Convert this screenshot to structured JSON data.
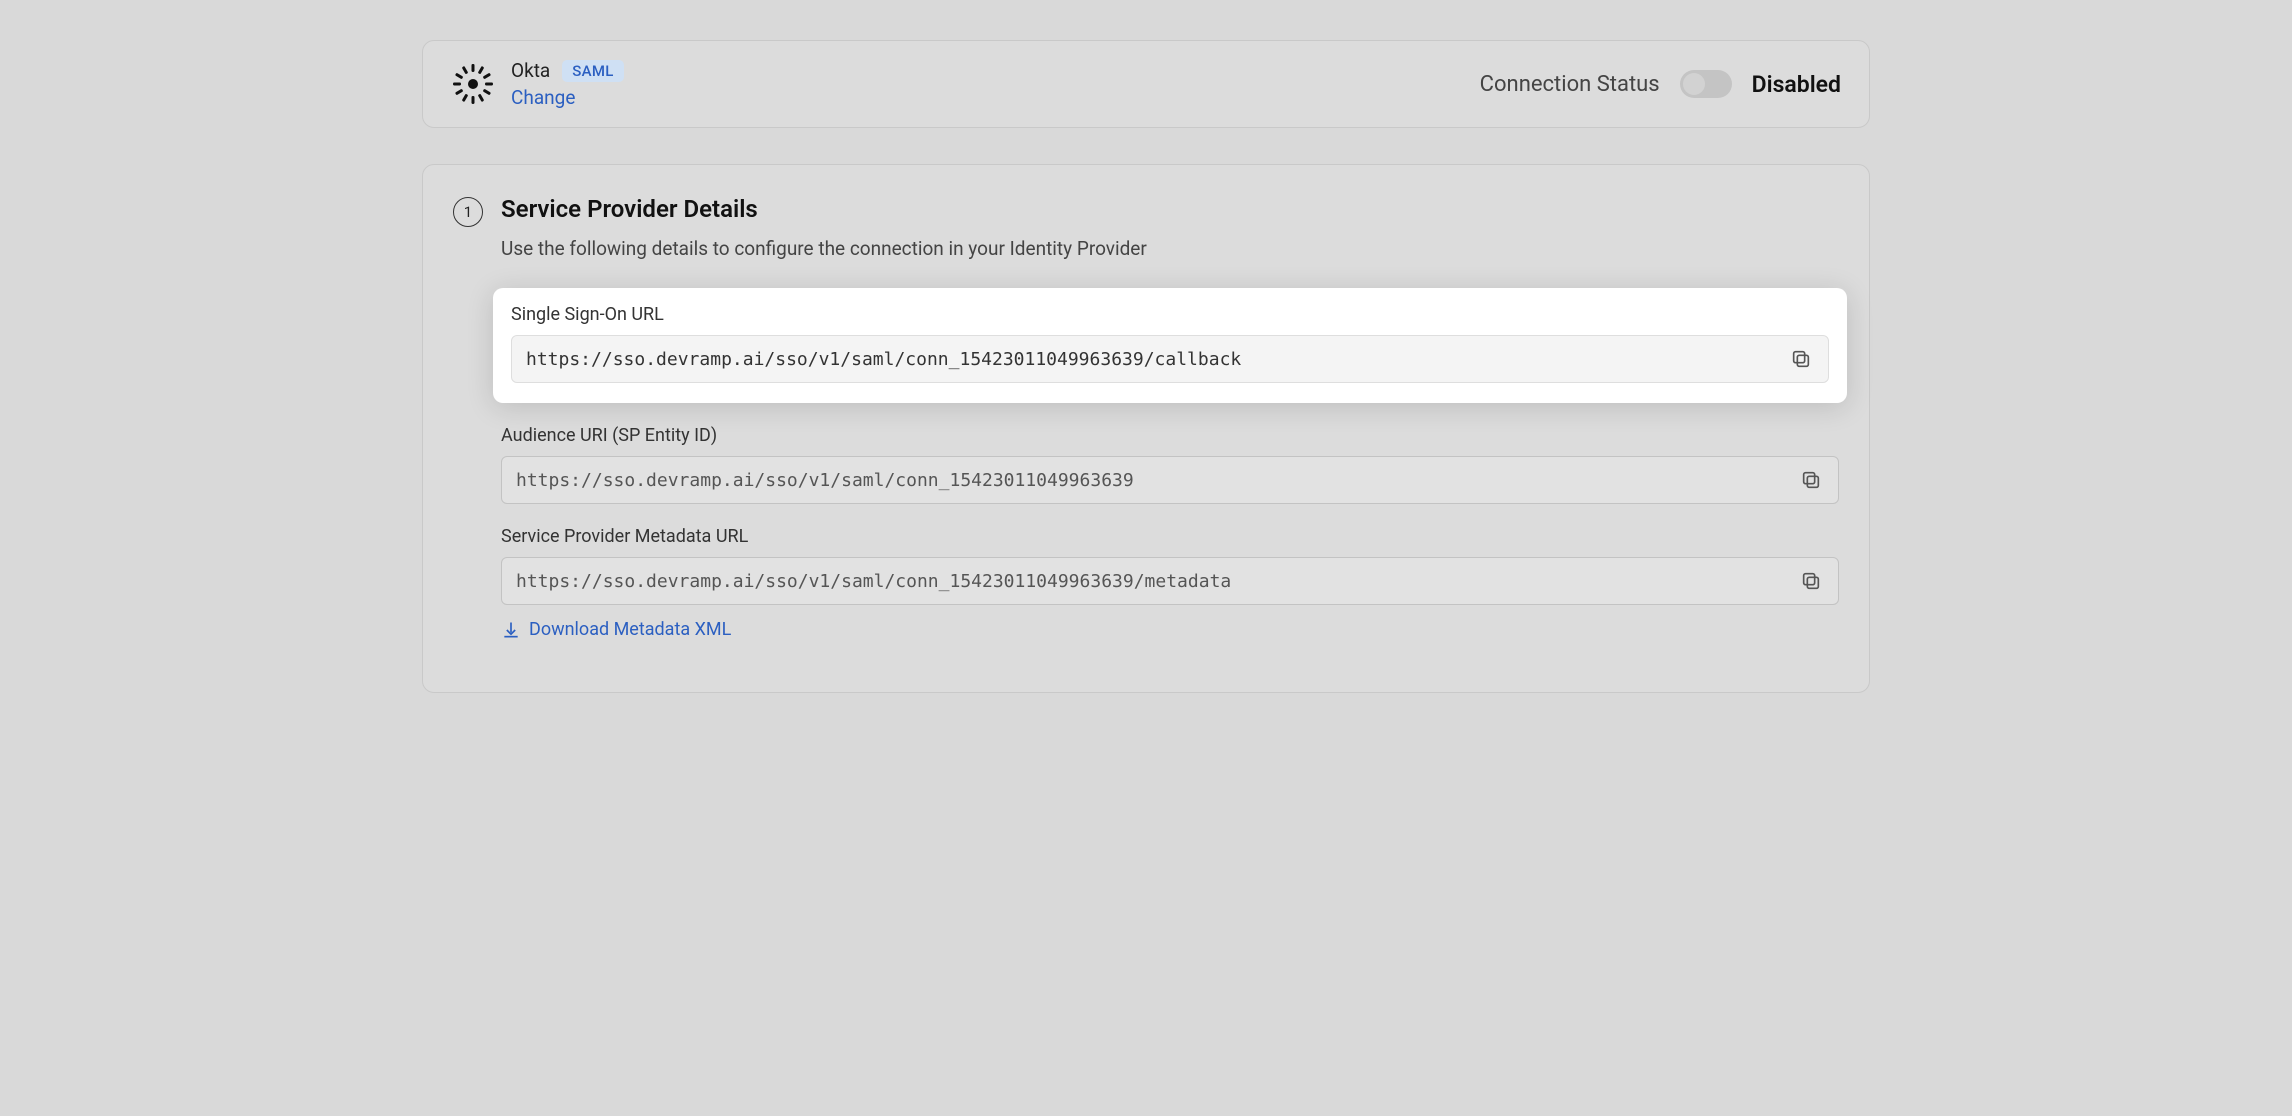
{
  "header": {
    "provider_name": "Okta",
    "badge": "SAML",
    "change_label": "Change",
    "status_label": "Connection Status",
    "status_value": "Disabled"
  },
  "section": {
    "step": "1",
    "title": "Service Provider Details",
    "description": "Use the following details to configure the connection in your Identity Provider"
  },
  "fields": {
    "sso": {
      "label": "Single Sign-On URL",
      "value": "https://sso.devramp.ai/sso/v1/saml/conn_15423011049963639/callback"
    },
    "audience": {
      "label": "Audience URI (SP Entity ID)",
      "value": "https://sso.devramp.ai/sso/v1/saml/conn_15423011049963639"
    },
    "metadata": {
      "label": "Service Provider Metadata URL",
      "value": "https://sso.devramp.ai/sso/v1/saml/conn_15423011049963639/metadata"
    }
  },
  "download_label": "Download Metadata XML"
}
